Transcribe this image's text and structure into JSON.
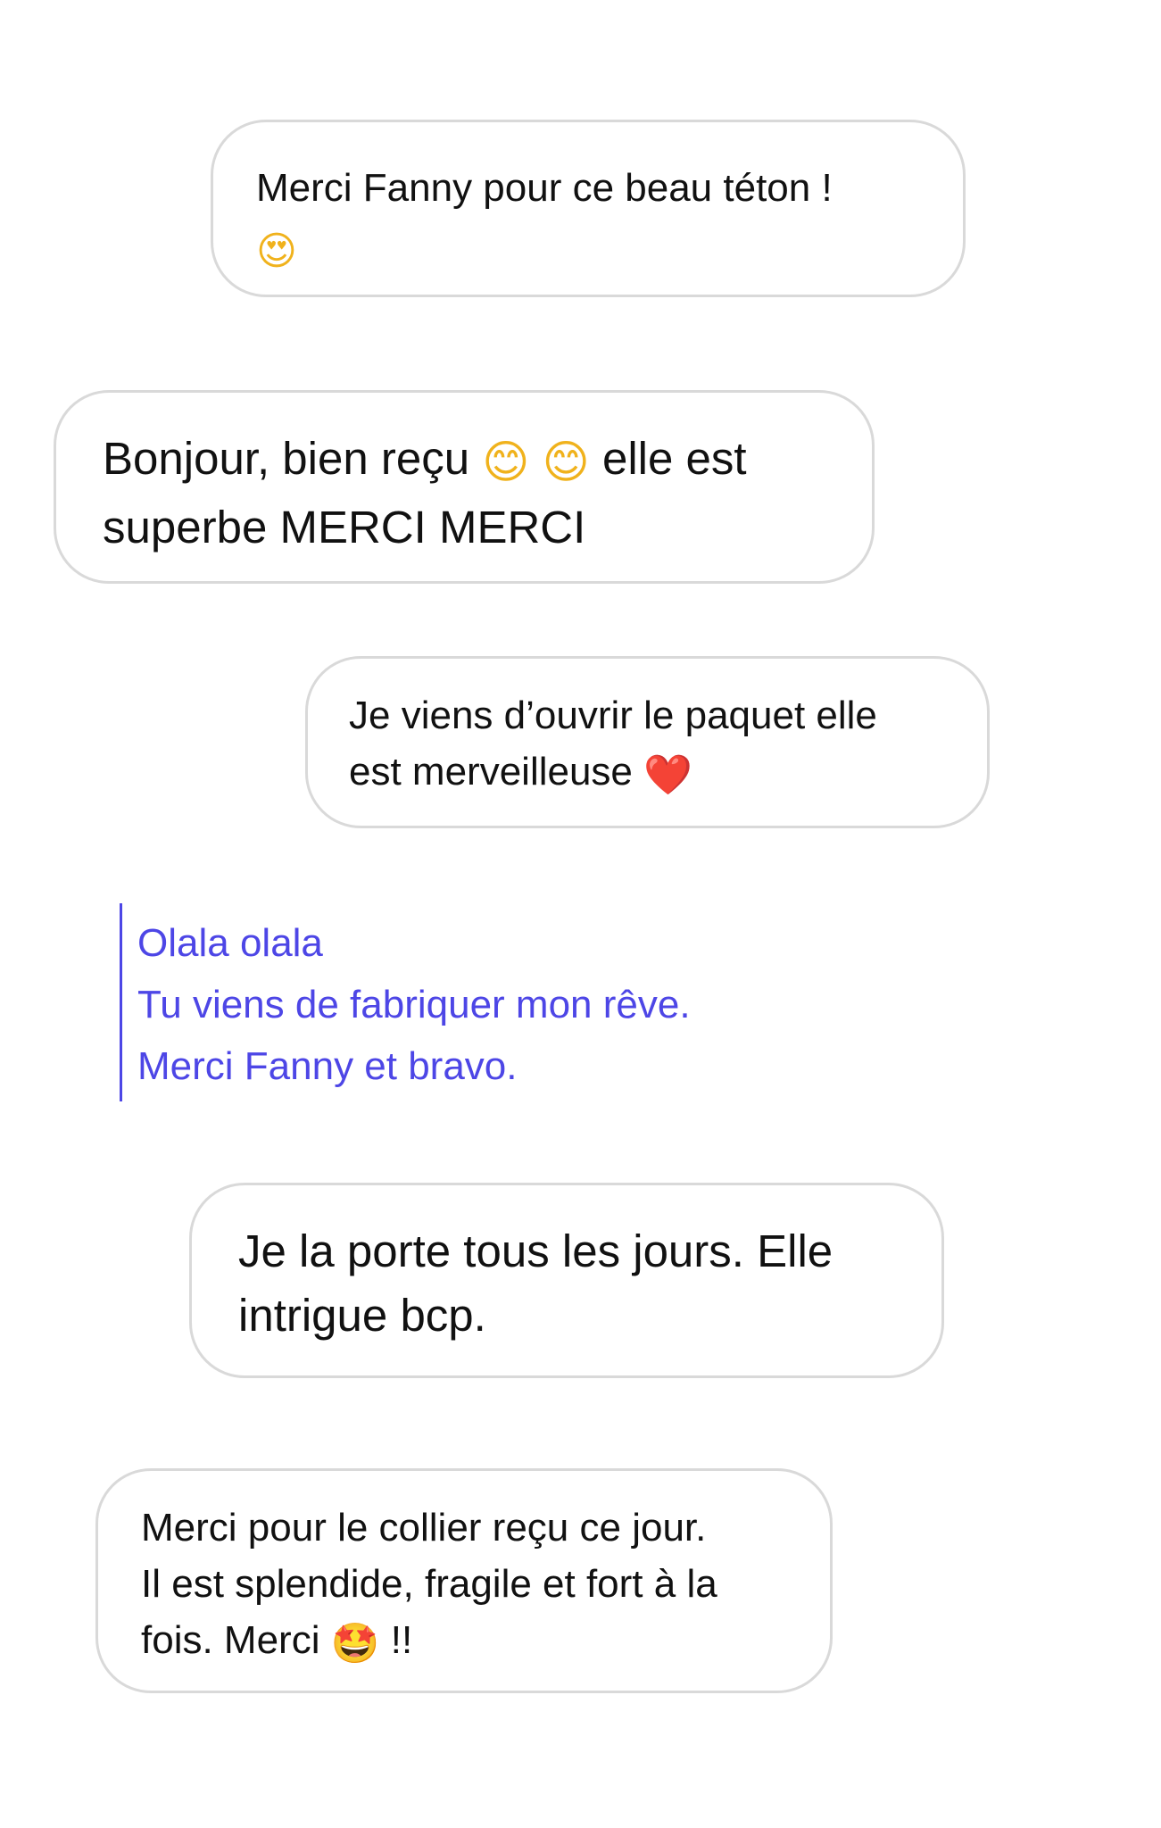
{
  "messages": [
    {
      "id": "m1",
      "text": "Merci Fanny pour ce beau téton !",
      "emoji": "😍"
    },
    {
      "id": "m2",
      "text_before": "Bonjour, bien reçu",
      "emoji_1": "😊",
      "emoji_2": "😊",
      "text_after": "elle est",
      "line2": "superbe MERCI MERCI"
    },
    {
      "id": "m3",
      "line1": "Je viens d’ouvrir le paquet elle",
      "line2": "est merveilleuse",
      "emoji": "❤️"
    },
    {
      "id": "m4",
      "quote_lines": [
        "Olala olala",
        "Tu viens de fabriquer mon rêve.",
        "Merci Fanny et bravo."
      ]
    },
    {
      "id": "m5",
      "line1": "Je la porte tous les jours. Elle",
      "line2": "intrigue bcp."
    },
    {
      "id": "m6",
      "line1": "Merci pour le collier reçu ce jour.",
      "line2": "Il est splendide, fragile et fort à la",
      "line3_before": "fois. Merci",
      "emoji": "🤩",
      "line3_after": "!!"
    }
  ],
  "colors": {
    "bubble_border": "#d9d9d9",
    "quote_accent": "#4d46e6",
    "text": "#111111",
    "background": "#ffffff"
  }
}
